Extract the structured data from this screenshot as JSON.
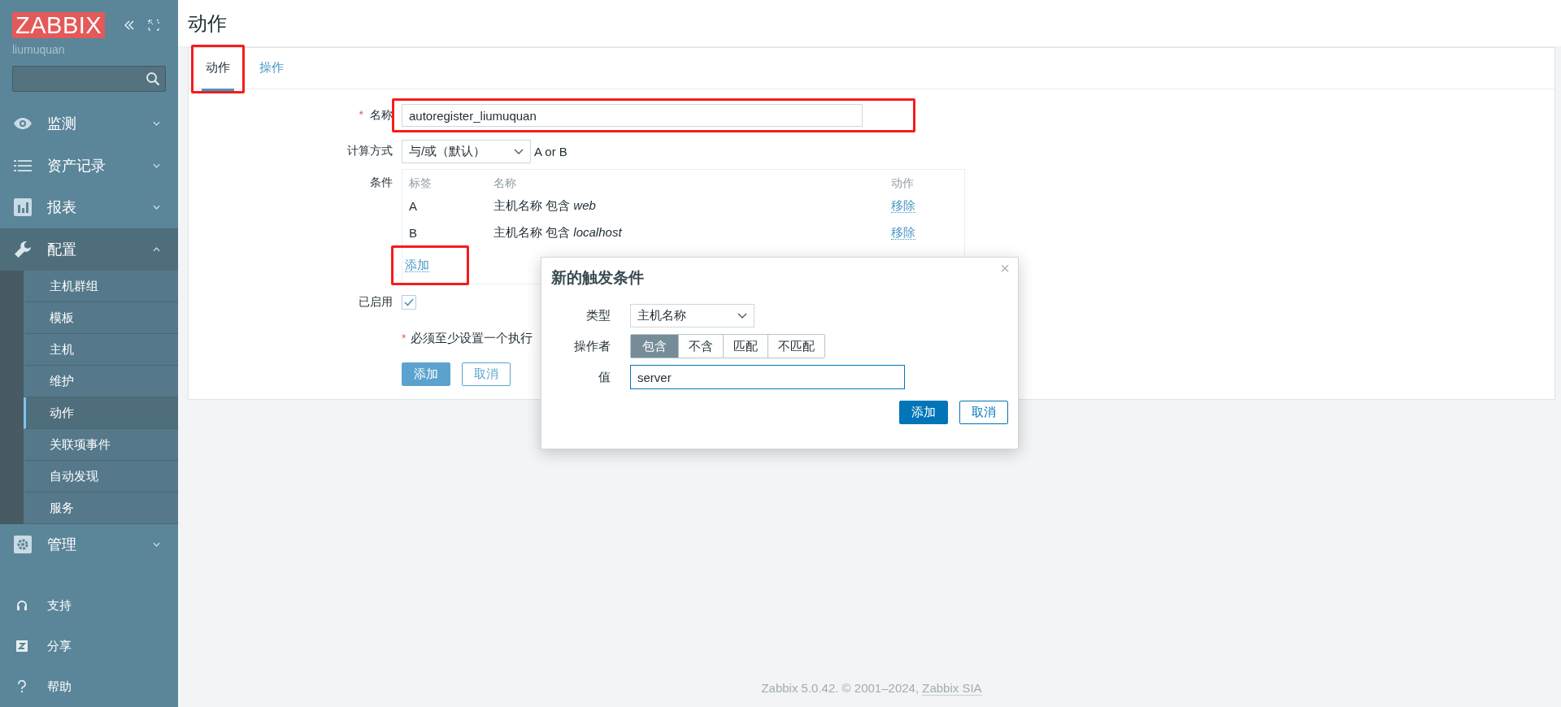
{
  "sidebar": {
    "logo": "ZABBIX",
    "user": "liumuquan",
    "menu": [
      {
        "label": "监测",
        "expanded": false
      },
      {
        "label": "资产记录",
        "expanded": false
      },
      {
        "label": "报表",
        "expanded": false
      },
      {
        "label": "配置",
        "expanded": true,
        "children": [
          {
            "label": "主机群组",
            "selected": false
          },
          {
            "label": "模板",
            "selected": false
          },
          {
            "label": "主机",
            "selected": false
          },
          {
            "label": "维护",
            "selected": false
          },
          {
            "label": "动作",
            "selected": true
          },
          {
            "label": "关联项事件",
            "selected": false
          },
          {
            "label": "自动发现",
            "selected": false
          },
          {
            "label": "服务",
            "selected": false
          }
        ]
      },
      {
        "label": "管理",
        "expanded": false
      }
    ],
    "bottom": [
      {
        "label": "支持"
      },
      {
        "label": "分享"
      },
      {
        "label": "帮助"
      }
    ]
  },
  "page_title": "动作",
  "tabs": [
    {
      "label": "动作",
      "selected": true,
      "highlighted": true
    },
    {
      "label": "操作",
      "selected": false,
      "highlighted": false
    }
  ],
  "form": {
    "name": {
      "required_mark": "*",
      "label": "名称",
      "value": "autoregister_liumuquan",
      "highlighted": true
    },
    "calc": {
      "label": "计算方式",
      "value": "与/或（默认）",
      "formula": "A or B"
    },
    "conditions": {
      "label": "条件",
      "columns": [
        "标签",
        "名称",
        "动作"
      ],
      "rows": [
        {
          "tag": "A",
          "text": "主机名称 包含 ",
          "value": "web",
          "action": "移除"
        },
        {
          "tag": "B",
          "text": "主机名称 包含 ",
          "value": "localhost",
          "action": "移除"
        }
      ],
      "add": {
        "label": "添加",
        "highlighted": true
      }
    },
    "enabled": {
      "label": "已启用",
      "checked": true
    },
    "note": {
      "required_mark": "*",
      "text": "必须至少设置一个执行"
    },
    "buttons": [
      "添加",
      "取消"
    ]
  },
  "dialog": {
    "title": "新的触发条件",
    "close": "×",
    "type": {
      "label": "类型",
      "value": "主机名称"
    },
    "operator": {
      "label": "操作者",
      "options": [
        {
          "label": "包含",
          "selected": true
        },
        {
          "label": "不含",
          "selected": false
        },
        {
          "label": "匹配",
          "selected": false
        },
        {
          "label": "不匹配",
          "selected": false
        }
      ]
    },
    "value": {
      "label": "值",
      "value": "server"
    },
    "buttons": [
      "添加",
      "取消"
    ]
  },
  "footer": {
    "text": "Zabbix 5.0.42. © 2001–2024, ",
    "link": "Zabbix SIA"
  }
}
